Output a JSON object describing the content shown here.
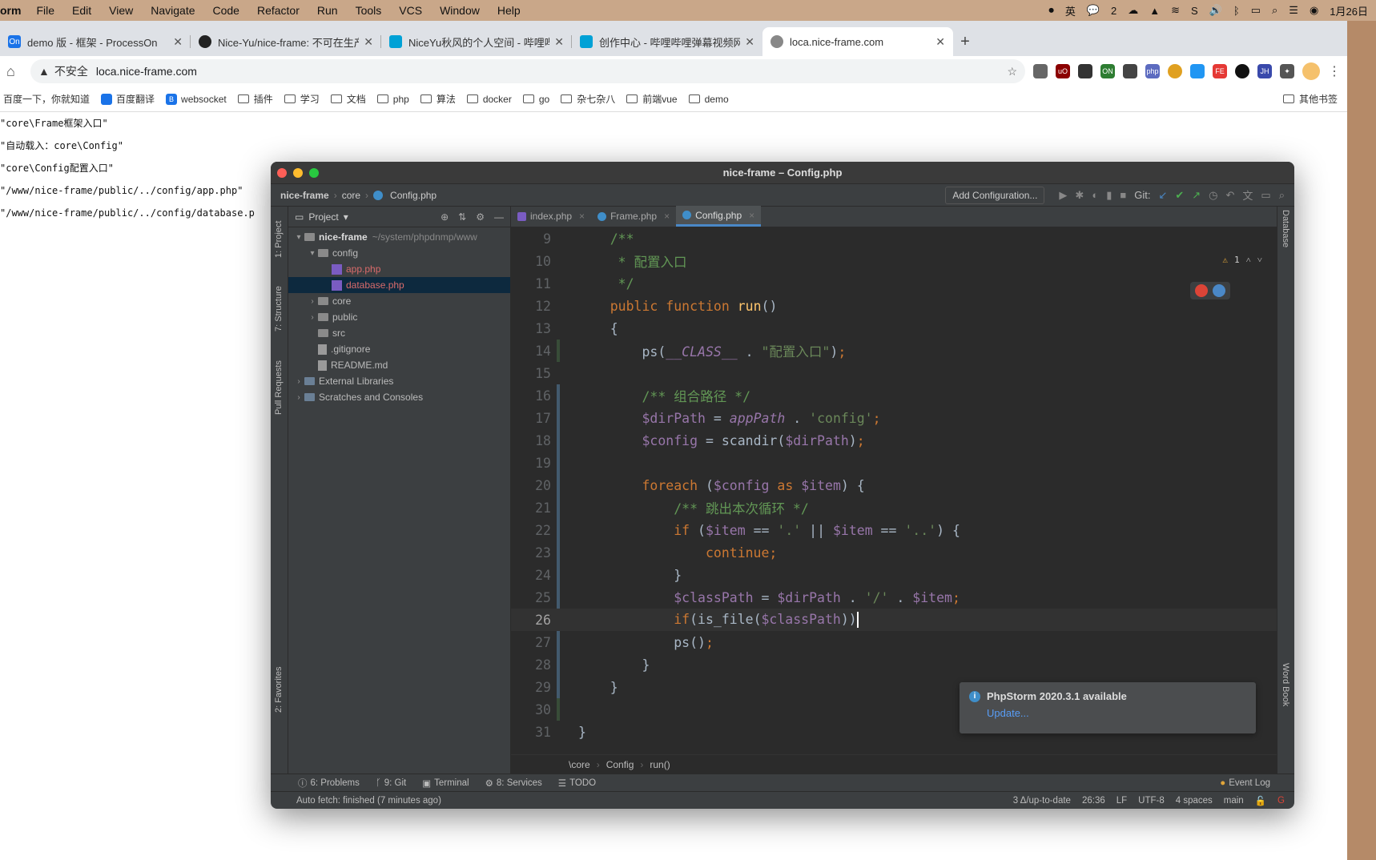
{
  "menubar": {
    "app": "orm",
    "items": [
      "File",
      "Edit",
      "View",
      "Navigate",
      "Code",
      "Refactor",
      "Run",
      "Tools",
      "VCS",
      "Window",
      "Help"
    ],
    "ime": "英",
    "wechat_count": "2",
    "datetime": "1月26日"
  },
  "browser": {
    "tabs": [
      {
        "icon": "On",
        "label": "demo 版 - 框架 - ProcessOn",
        "color": "#1a73e8"
      },
      {
        "icon": "GH",
        "label": "Nice-Yu/nice-frame: 不可在生产",
        "color": "#222"
      },
      {
        "icon": "B",
        "label": "NiceYu秋风的个人空间 - 哔哩哔哩",
        "color": "#00a1d6"
      },
      {
        "icon": "B",
        "label": "创作中心 - 哔哩哔哩弹幕视频网",
        "color": "#00a1d6"
      },
      {
        "icon": "◎",
        "label": "loca.nice-frame.com",
        "color": "#666"
      }
    ],
    "insecure_label": "不安全",
    "url": "loca.nice-frame.com",
    "bookmarks": [
      {
        "label": "百度一下，你就知道",
        "type": "link"
      },
      {
        "label": "百度翻译",
        "type": "icon"
      },
      {
        "label": "websocket",
        "type": "icon"
      },
      {
        "label": "插件",
        "type": "folder"
      },
      {
        "label": "学习",
        "type": "folder"
      },
      {
        "label": "文档",
        "type": "folder"
      },
      {
        "label": "php",
        "type": "folder"
      },
      {
        "label": "算法",
        "type": "folder"
      },
      {
        "label": "docker",
        "type": "folder"
      },
      {
        "label": "go",
        "type": "folder"
      },
      {
        "label": "杂七杂八",
        "type": "folder"
      },
      {
        "label": "前端vue",
        "type": "folder"
      },
      {
        "label": "demo",
        "type": "folder"
      }
    ],
    "other_bookmarks": "其他书签"
  },
  "page_output": [
    "\"core\\Frame框架入口\"",
    "\"自动载入：core\\Config\"",
    "\"core\\Config配置入口\"",
    "\"/www/nice-frame/public/../config/app.php\"",
    "\"/www/nice-frame/public/../config/database.p"
  ],
  "ide": {
    "title": "nice-frame – Config.php",
    "breadcrumbs": [
      "nice-frame",
      "core",
      "Config.php"
    ],
    "add_config": "Add Configuration...",
    "git_label": "Git:",
    "left_tools": [
      "1: Project",
      "7: Structure",
      "Pull Requests",
      "2: Favorites"
    ],
    "right_tools": [
      "Database",
      "Word Book"
    ],
    "project_header": "Project",
    "tree": [
      {
        "level": 0,
        "arrow": "▾",
        "kind": "folder",
        "label": "nice-frame",
        "extra": "~/system/phpdnmp/www"
      },
      {
        "level": 1,
        "arrow": "▾",
        "kind": "folder",
        "label": "config",
        "extra": ""
      },
      {
        "level": 2,
        "arrow": "",
        "kind": "php",
        "label": "app.php",
        "extra": ""
      },
      {
        "level": 2,
        "arrow": "",
        "kind": "php",
        "label": "database.php",
        "extra": ""
      },
      {
        "level": 1,
        "arrow": "›",
        "kind": "folder",
        "label": "core",
        "extra": ""
      },
      {
        "level": 1,
        "arrow": "›",
        "kind": "folder",
        "label": "public",
        "extra": ""
      },
      {
        "level": 1,
        "arrow": "",
        "kind": "folder",
        "label": "src",
        "extra": ""
      },
      {
        "level": 1,
        "arrow": "",
        "kind": "file",
        "label": ".gitignore",
        "extra": ""
      },
      {
        "level": 1,
        "arrow": "",
        "kind": "file",
        "label": "README.md",
        "extra": ""
      },
      {
        "level": 0,
        "arrow": "›",
        "kind": "lib",
        "label": "External Libraries",
        "extra": ""
      },
      {
        "level": 0,
        "arrow": "›",
        "kind": "lib",
        "label": "Scratches and Consoles",
        "extra": ""
      }
    ],
    "editor_tabs": [
      "index.php",
      "Frame.php",
      "Config.php"
    ],
    "active_tab": "Config.php",
    "line_numbers": [
      "9",
      "10",
      "11",
      "12",
      "13",
      "14",
      "15",
      "16",
      "17",
      "18",
      "19",
      "20",
      "21",
      "22",
      "23",
      "24",
      "25",
      "26",
      "27",
      "28",
      "29",
      "30",
      "31"
    ],
    "current_line": "26",
    "warning_count": "1",
    "code_breadcrumb": [
      "\\core",
      "Config",
      "run()"
    ],
    "notification": {
      "title": "PhpStorm 2020.3.1 available",
      "link": "Update..."
    },
    "bottom_tools": [
      "6: Problems",
      "9: Git",
      "Terminal",
      "8: Services",
      "TODO"
    ],
    "event_log": "Event Log",
    "status_left": "Auto fetch: finished (7 minutes ago)",
    "status_right": [
      "3 Δ/up-to-date",
      "26:36",
      "LF",
      "UTF-8",
      "4 spaces",
      "main"
    ]
  }
}
